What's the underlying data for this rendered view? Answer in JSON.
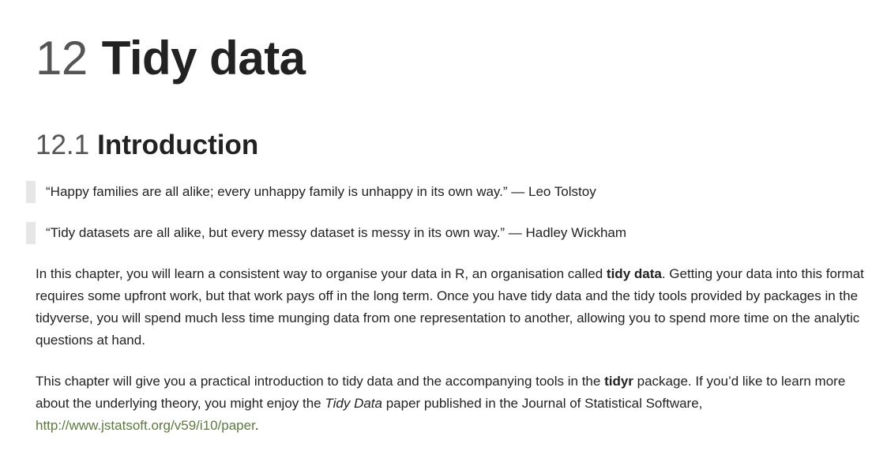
{
  "chapter": {
    "number": "12",
    "title": "Tidy data"
  },
  "section": {
    "number": "12.1",
    "title": "Introduction"
  },
  "quotes": [
    "“Happy families are all alike; every unhappy family is unhappy in its own way.” — Leo Tolstoy",
    "“Tidy datasets are all alike, but every messy dataset is messy in its own way.” — Hadley Wickham"
  ],
  "paragraph1": {
    "before": "In this chapter, you will learn a consistent way to organise your data in R, an organisation called ",
    "bold": "tidy data",
    "after": ". Getting your data into this format requires some upfront work, but that work pays off in the long term. Once you have tidy data and the tidy tools provided by packages in the tidyverse, you will spend much less time munging data from one representation to another, allowing you to spend more time on the analytic questions at hand."
  },
  "paragraph2": {
    "before": "This chapter will give you a practical introduction to tidy data and the accompanying tools in the ",
    "bold": "tidyr",
    "middle": " package. If you’d like to learn more about the underlying theory, you might enjoy the ",
    "italic": "Tidy Data",
    "after": " paper published in the Journal of Statistical Software, ",
    "link": "http://www.jstatsoft.org/v59/i10/paper",
    "end": "."
  },
  "colors": {
    "text": "#222222",
    "number": "#555555",
    "quote_bar": "#e6e6e6",
    "link": "#5c7a3d"
  }
}
